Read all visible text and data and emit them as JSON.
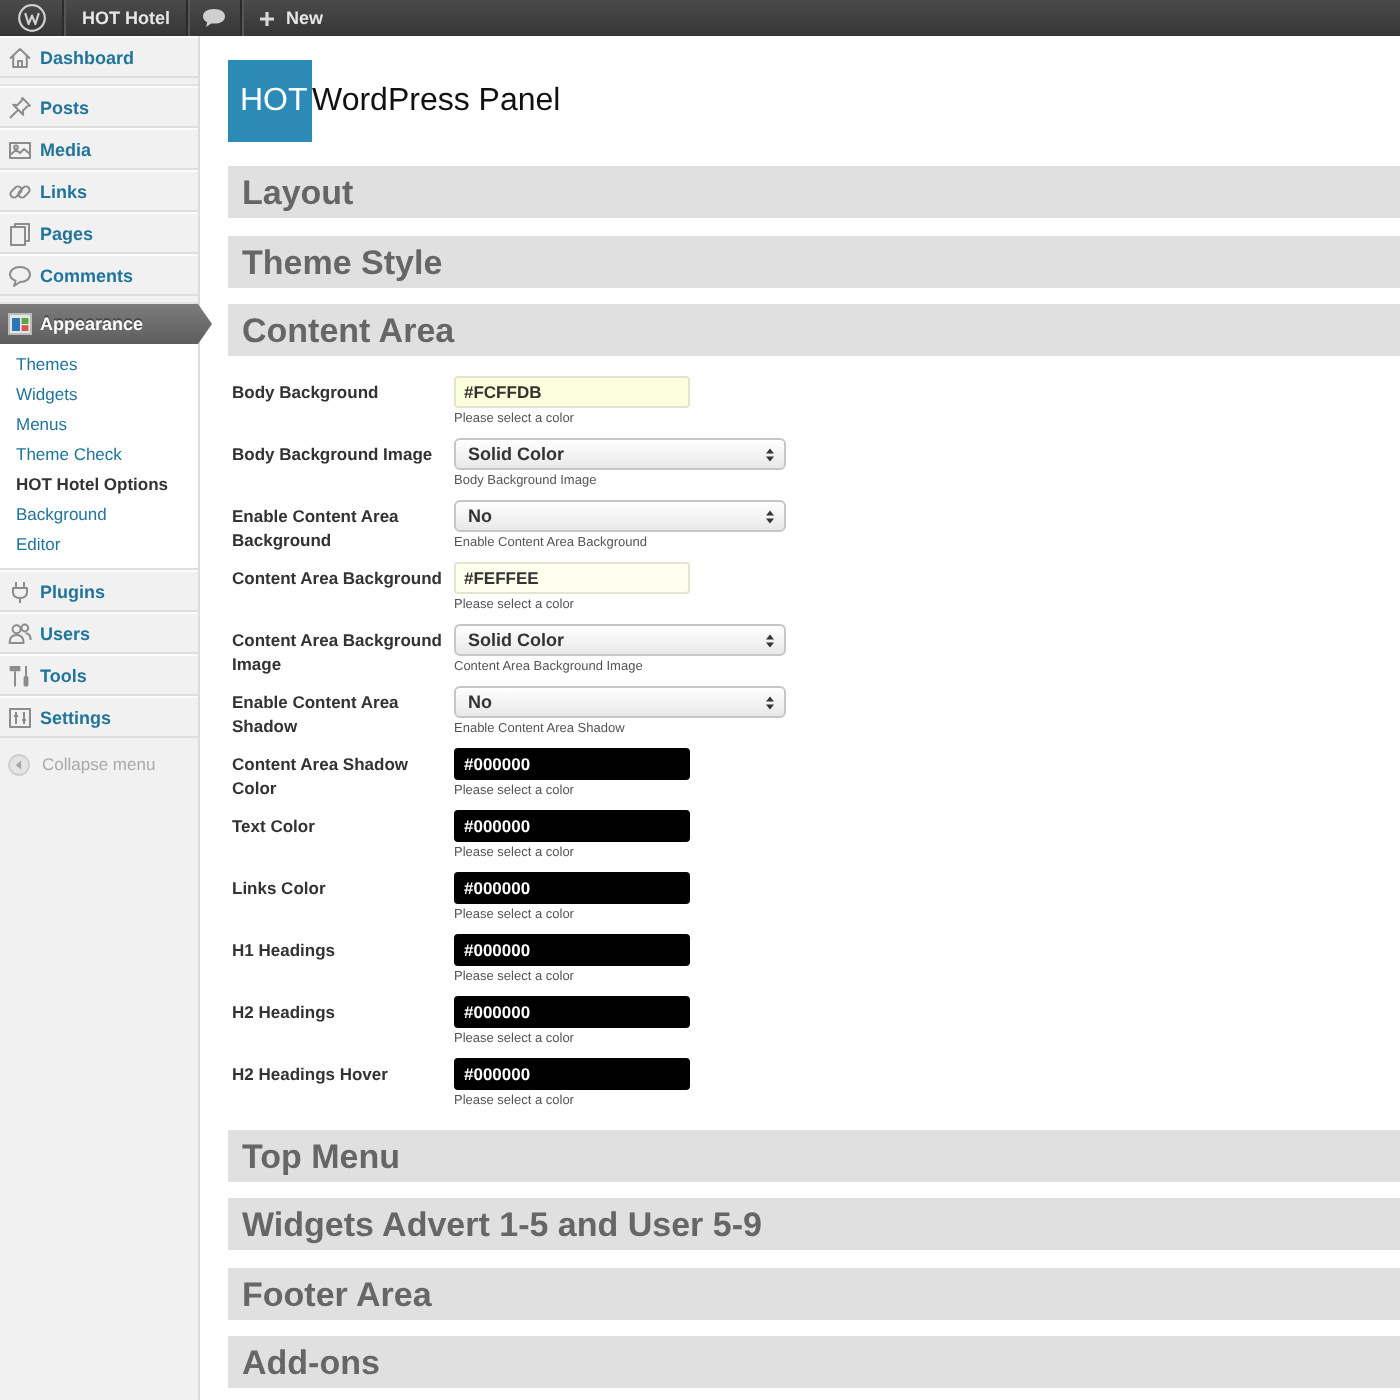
{
  "admin_bar": {
    "site_name": "HOT Hotel",
    "new_label": "New"
  },
  "sidebar": {
    "groups": [
      {
        "items": [
          {
            "label": "Dashboard",
            "selected": false
          }
        ]
      },
      {
        "items": [
          {
            "label": "Posts",
            "selected": false
          },
          {
            "label": "Media",
            "selected": false
          },
          {
            "label": "Links",
            "selected": false
          },
          {
            "label": "Pages",
            "selected": false
          },
          {
            "label": "Comments",
            "selected": false
          }
        ]
      },
      {
        "items": [
          {
            "label": "Appearance",
            "selected": true,
            "submenu": [
              {
                "label": "Themes",
                "selected": false
              },
              {
                "label": "Widgets",
                "selected": false
              },
              {
                "label": "Menus",
                "selected": false
              },
              {
                "label": "Theme Check",
                "selected": false
              },
              {
                "label": "HOT Hotel Options",
                "selected": true
              },
              {
                "label": "Background",
                "selected": false
              },
              {
                "label": "Editor",
                "selected": false
              }
            ]
          },
          {
            "label": "Plugins",
            "selected": false
          },
          {
            "label": "Users",
            "selected": false
          },
          {
            "label": "Tools",
            "selected": false
          },
          {
            "label": "Settings",
            "selected": false
          }
        ]
      }
    ],
    "collapse_label": "Collapse menu"
  },
  "logo": {
    "badge": "HOT",
    "title": "WordPress Panel"
  },
  "sections": [
    {
      "title": "Layout"
    },
    {
      "title": "Theme Style"
    },
    {
      "title": "Content Area",
      "fields": [
        {
          "kind": "color",
          "label": "Body Background",
          "value": "#FCFFDB",
          "color": "#fcffdb",
          "hint": "Please select a color"
        },
        {
          "kind": "select",
          "label": "Body Background Image",
          "value": "Solid Color",
          "hint": "Body Background Image"
        },
        {
          "kind": "select",
          "label": "Enable Content Area Background",
          "value": "No",
          "hint": "Enable Content Area Background"
        },
        {
          "kind": "color",
          "label": "Content Area Background",
          "value": "#FEFFEE",
          "color": "#feffee",
          "hint": "Please select a color"
        },
        {
          "kind": "select",
          "label": "Content Area Background Image",
          "value": "Solid Color",
          "hint": "Content Area Background Image"
        },
        {
          "kind": "select",
          "label": "Enable Content Area Shadow",
          "value": "No",
          "hint": "Enable Content Area Shadow"
        },
        {
          "kind": "color",
          "label": "Content Area Shadow Color",
          "value": "#000000",
          "color": "#000000",
          "hint": "Please select a color"
        },
        {
          "kind": "color",
          "label": "Text Color",
          "value": "#000000",
          "color": "#000000",
          "hint": "Please select a color"
        },
        {
          "kind": "color",
          "label": "Links Color",
          "value": "#000000",
          "color": "#000000",
          "hint": "Please select a color"
        },
        {
          "kind": "color",
          "label": "H1 Headings",
          "value": "#000000",
          "color": "#000000",
          "hint": "Please select a color"
        },
        {
          "kind": "color",
          "label": "H2 Headings",
          "value": "#000000",
          "color": "#000000",
          "hint": "Please select a color"
        },
        {
          "kind": "color",
          "label": "H2 Headings Hover",
          "value": "#000000",
          "color": "#000000",
          "hint": "Please select a color"
        }
      ]
    },
    {
      "title": "Top Menu"
    },
    {
      "title": "Widgets Advert 1-5 and User 5-9"
    },
    {
      "title": "Footer Area"
    },
    {
      "title": "Add-ons"
    }
  ]
}
